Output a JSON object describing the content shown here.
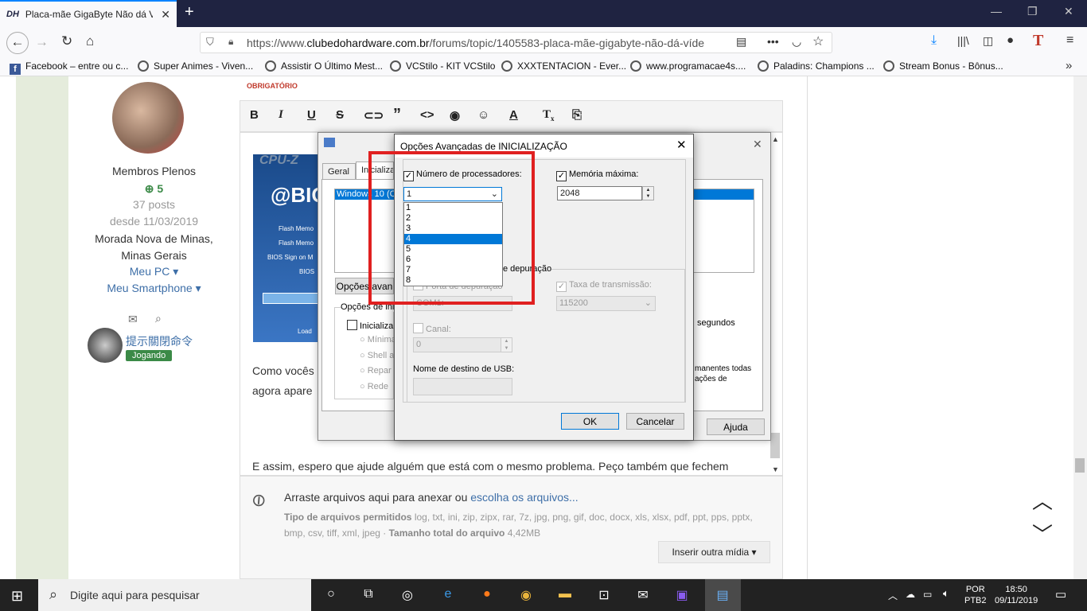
{
  "browser": {
    "tab_title": "Placa-mãe GigaByte Não dá Víde",
    "tab_favicon": "DH",
    "url_prefix": "https://www.",
    "url_domain": "clubedohardware.com.br",
    "url_path": "/forums/topic/1405583-placa-mãe-gigabyte-não-dá-víde"
  },
  "bookmarks": [
    "Facebook – entre ou c...",
    "Super Animes - Viven...",
    "Assistir O Último Mest...",
    "VCStilo - KIT VCStilo",
    "XXXTENTACION - Ever...",
    "www.programacae4s....",
    "Paladins: Champions ...",
    "Stream Bonus - Bônus..."
  ],
  "sidebar": {
    "group": "Membros Plenos",
    "rep": "5",
    "posts": "37 posts",
    "since": "desde 11/03/2019",
    "location1": "Morada Nova de Minas,",
    "location2": "Minas Gerais",
    "my_pc": "Meu PC",
    "my_phone": "Meu Smartphone",
    "user2_name": "提示關閉命令",
    "user2_badge": "Jogando"
  },
  "editor": {
    "required_label": "OBRIGATÓRIO",
    "para1a": "Como vocês",
    "para1b": "agora apare",
    "para1_right1": "manentes todas",
    "para1_right2": "ações de",
    "para2": "E assim, espero que ajude alguém que está com o mesmo problema. Peço também que fechem"
  },
  "attach": {
    "drag_text": "Arraste arquivos aqui para anexar ou",
    "choose_link": "escolha os arquivos...",
    "types_label": "Tipo de arquivos permitidos",
    "types": "log, txt, ini, zip, zipx, rar, 7z, jpg, png, gif, doc, docx, xls, xlsx, pdf, ppt, pps, pptx, bmp, csv, tiff, xml, jpeg",
    "size_label": "Tamanho total do arquivo",
    "size": "4,42MB",
    "insert_button": "Inserir outra mídia"
  },
  "cpuz": {
    "logo": "CPU-Z",
    "tab_general": "Geral",
    "tab_boot": "Inicializa",
    "boot_entry": "Windows 10 (C",
    "adv_button": "Opções avan",
    "boot_options": "Opções de ini",
    "safe_boot": "Inicializa",
    "radio1": "Mínima",
    "radio2": "Shell a",
    "radio3": "Repar",
    "radio4": "Rede",
    "seconds": "segundos",
    "help_button": "Ajuda",
    "bios_text": "@BIO",
    "flash1": "Flash Memo",
    "flash2": "Flash Memo",
    "bios_sign": "BIOS Sign on M",
    "bios": "BIOS",
    "load": "Load"
  },
  "dialog": {
    "title": "Opções Avançadas de INICIALIZAÇÃO",
    "num_proc_label": "Número de processadores:",
    "num_proc_value": "1",
    "proc_options": [
      "1",
      "2",
      "3",
      "4",
      "5",
      "6",
      "7",
      "8"
    ],
    "proc_highlighted": "4",
    "max_mem_label": "Memória máxima:",
    "max_mem_value": "2048",
    "debug_group": "e depuração",
    "debug_port_label": "Porta de depuração",
    "debug_port_value": "COM1:",
    "baud_label": "Taxa de transmissão:",
    "baud_value": "115200",
    "channel_label": "Canal:",
    "channel_value": "0",
    "usb_label": "Nome de destino de USB:",
    "ok": "OK",
    "cancel": "Cancelar"
  },
  "taskbar": {
    "search_placeholder": "Digite aqui para pesquisar",
    "lang1": "POR",
    "lang2": "PTB2",
    "time": "18:50",
    "date": "09/11/2019"
  }
}
